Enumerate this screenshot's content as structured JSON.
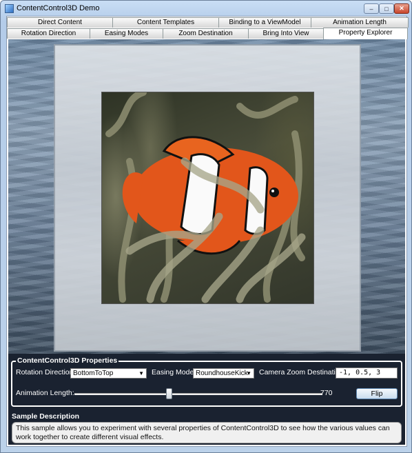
{
  "window": {
    "title": "ContentControl3D Demo",
    "minimize": "‒",
    "maximize": "□",
    "close": "✕"
  },
  "tabs": {
    "row1": [
      {
        "label": "Direct Content"
      },
      {
        "label": "Content Templates"
      },
      {
        "label": "Binding to a ViewModel"
      },
      {
        "label": "Animation Length"
      }
    ],
    "row2": [
      {
        "label": "Rotation Direction"
      },
      {
        "label": "Easing Modes"
      },
      {
        "label": "Zoom Destination"
      },
      {
        "label": "Bring Into View"
      },
      {
        "label": "Property Explorer",
        "selected": true
      }
    ]
  },
  "properties": {
    "group_title": "ContentControl3D Properties",
    "rotation_direction_label": "Rotation Direction:",
    "rotation_direction_value": "BottomToTop",
    "easing_mode_label": "Easing Mode:",
    "easing_mode_value": "RoundhouseKick",
    "camera_zoom_label": "Camera Zoom Destination:",
    "camera_zoom_value": "-1, 0.5, 3",
    "animation_length_label": "Animation Length:",
    "animation_length_value": "770",
    "slider_fraction": 0.38,
    "flip_label": "Flip"
  },
  "description": {
    "title": "Sample Description",
    "text": "This sample allows you to experiment with several properties of ContentControl3D to see how the various values can work together to create different visual effects."
  },
  "colors": {
    "content_background": "#1a2230",
    "accent": "#5e88b3"
  }
}
